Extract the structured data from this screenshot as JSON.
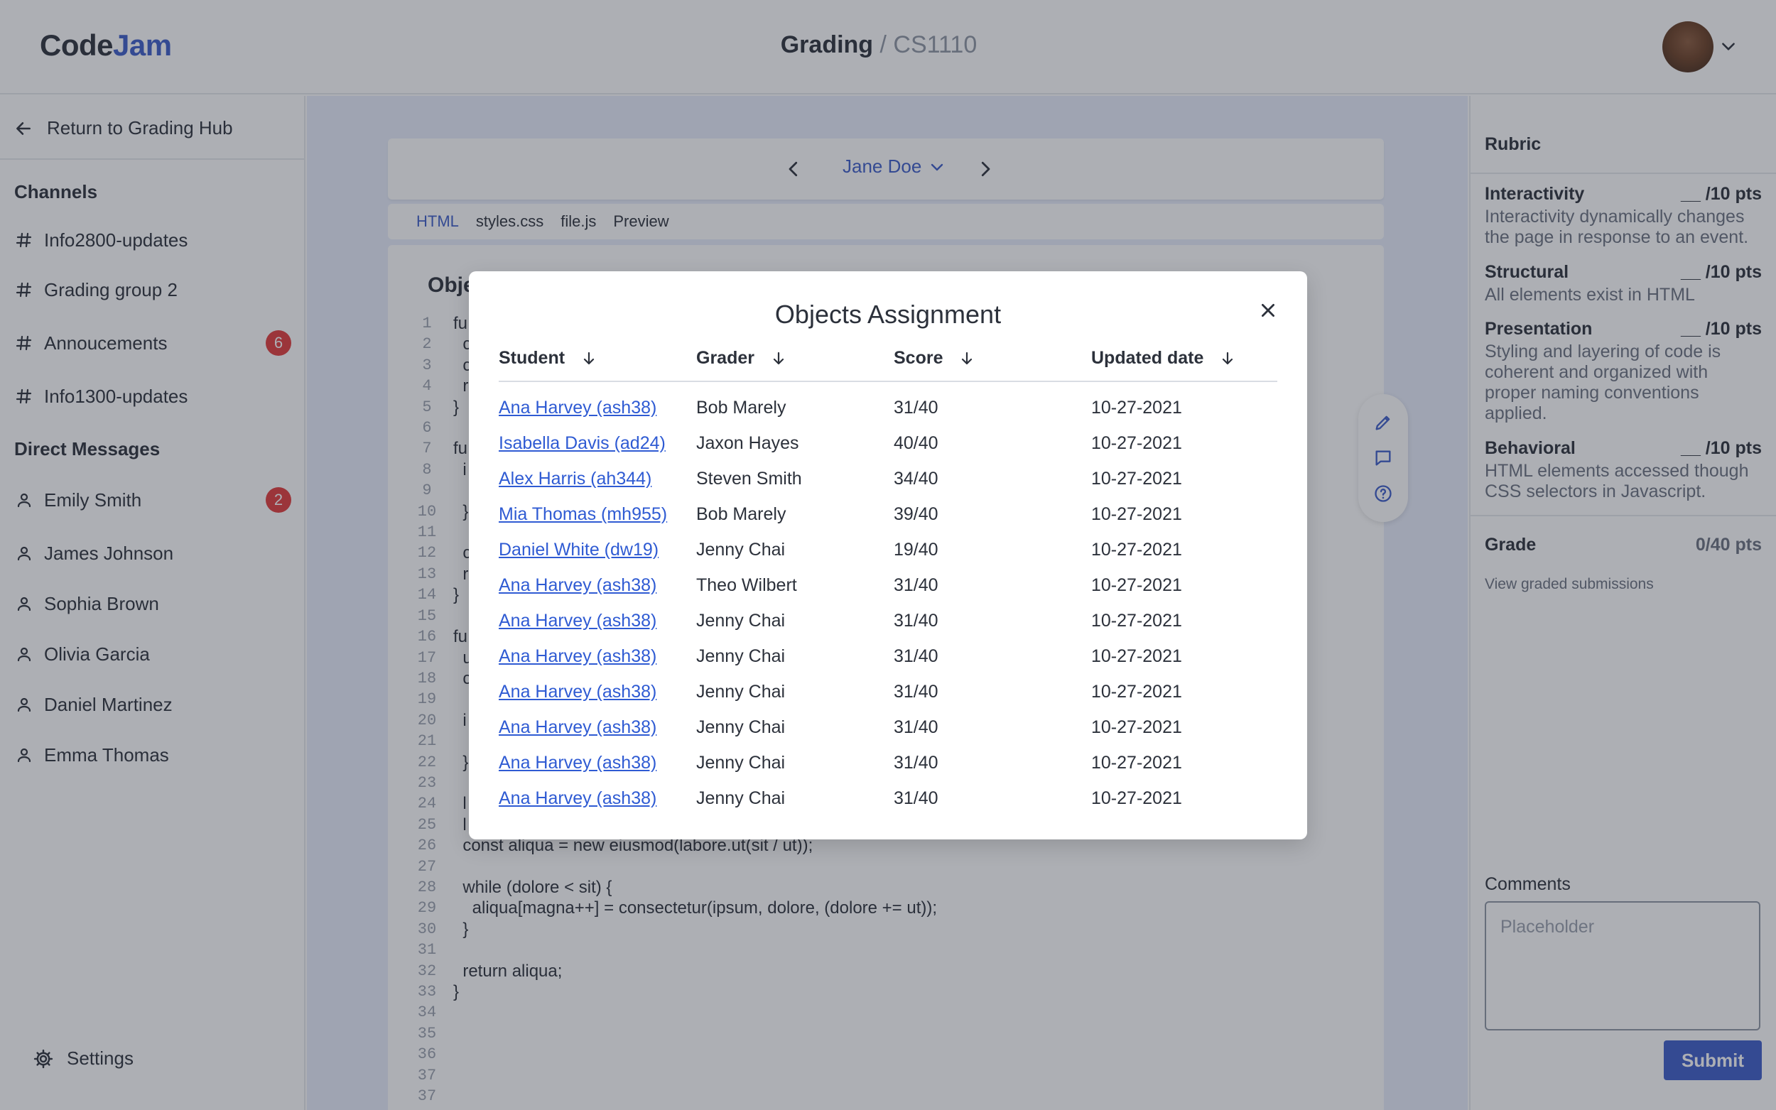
{
  "header": {
    "logo_part1": "Code",
    "logo_part2": "Jam",
    "title_main": "Grading",
    "title_sep": " / ",
    "title_course": "CS1110"
  },
  "sidebar": {
    "return_label": "Return to Grading Hub",
    "channels_title": "Channels",
    "channels": [
      {
        "label": "Info2800-updates",
        "badge": ""
      },
      {
        "label": "Grading group 2",
        "badge": ""
      },
      {
        "label": "Annoucements",
        "badge": "6"
      },
      {
        "label": "Info1300-updates",
        "badge": ""
      }
    ],
    "dm_title": "Direct Messages",
    "dms": [
      {
        "label": "Emily Smith",
        "badge": "2"
      },
      {
        "label": "James Johnson",
        "badge": ""
      },
      {
        "label": "Sophia Brown",
        "badge": ""
      },
      {
        "label": "Olivia Garcia",
        "badge": ""
      },
      {
        "label": "Daniel Martinez",
        "badge": ""
      },
      {
        "label": "Emma Thomas",
        "badge": ""
      }
    ],
    "settings_label": "Settings"
  },
  "main": {
    "student_name": "Jane Doe",
    "file_tabs": [
      "HTML",
      "styles.css",
      "file.js",
      "Preview"
    ],
    "active_tab": "HTML",
    "code_title": "Obje",
    "line_numbers": [
      "1",
      "2",
      "3",
      "4",
      "5",
      "6",
      "7",
      "8",
      "9",
      "10",
      "11",
      "12",
      "13",
      "14",
      "15",
      "16",
      "17",
      "18",
      "19",
      "20",
      "21",
      "22",
      "23",
      "24",
      "25",
      "26",
      "27",
      "28",
      "29",
      "30",
      "31",
      "32",
      "33",
      "34",
      "35",
      "36",
      "37",
      "37"
    ],
    "code_lines": [
      "fu",
      "  c",
      "  c",
      "  r",
      "}",
      "",
      "fu",
      "  i",
      "",
      "  }",
      "",
      "  c",
      "  r",
      "}",
      "",
      "fu",
      "  u",
      "  c",
      "",
      "  i",
      "",
      "  }",
      "",
      "  l",
      "  l",
      "  const aliqua = new eiusmod(labore.ut(sit / ut));",
      "",
      "  while (dolore < sit) {",
      "    aliqua[magna++] = consectetur(ipsum, dolore, (dolore += ut));",
      "  }",
      "",
      "  return aliqua;",
      "}",
      "",
      "",
      "",
      "",
      ""
    ]
  },
  "rubric": {
    "title": "Rubric",
    "criteria": [
      {
        "name": "Interactivity",
        "points": "__ /10 pts",
        "desc": "Interactivity dynamically changes the page in response to an event."
      },
      {
        "name": "Structural",
        "points": "__ /10 pts",
        "desc": "All elements exist in HTML"
      },
      {
        "name": "Presentation",
        "points": "__ /10 pts",
        "desc": "Styling and layering of code is coherent and organized with proper naming conventions applied."
      },
      {
        "name": "Behavioral",
        "points": "__ /10 pts",
        "desc": "HTML elements accessed though CSS selectors in Javascript."
      }
    ],
    "grade_label": "Grade",
    "grade_value": "0/40 pts",
    "view_link": "View graded submissions",
    "comments_label": "Comments",
    "comments_placeholder": "Placeholder",
    "submit_label": "Submit"
  },
  "modal": {
    "title": "Objects Assignment",
    "columns": [
      "Student",
      "Grader",
      "Score",
      "Updated date"
    ],
    "rows": [
      {
        "student": "Ana Harvey (ash38)",
        "grader": "Bob Marely",
        "score": "31/40",
        "date": "10-27-2021"
      },
      {
        "student": "Isabella Davis (ad24)",
        "grader": "Jaxon Hayes",
        "score": "40/40",
        "date": "10-27-2021"
      },
      {
        "student": "Alex Harris (ah344)",
        "grader": "Steven Smith",
        "score": "34/40",
        "date": "10-27-2021"
      },
      {
        "student": "Mia Thomas (mh955)",
        "grader": "Bob Marely",
        "score": "39/40",
        "date": "10-27-2021"
      },
      {
        "student": "Daniel White (dw19)",
        "grader": "Jenny Chai",
        "score": "19/40",
        "date": "10-27-2021"
      },
      {
        "student": "Ana Harvey (ash38)",
        "grader": "Theo Wilbert",
        "score": "31/40",
        "date": "10-27-2021"
      },
      {
        "student": "Ana Harvey (ash38)",
        "grader": "Jenny Chai",
        "score": "31/40",
        "date": "10-27-2021"
      },
      {
        "student": "Ana Harvey (ash38)",
        "grader": "Jenny Chai",
        "score": "31/40",
        "date": "10-27-2021"
      },
      {
        "student": "Ana Harvey (ash38)",
        "grader": "Jenny Chai",
        "score": "31/40",
        "date": "10-27-2021"
      },
      {
        "student": "Ana Harvey (ash38)",
        "grader": "Jenny Chai",
        "score": "31/40",
        "date": "10-27-2021"
      },
      {
        "student": "Ana Harvey (ash38)",
        "grader": "Jenny Chai",
        "score": "31/40",
        "date": "10-27-2021"
      },
      {
        "student": "Ana Harvey (ash38)",
        "grader": "Jenny Chai",
        "score": "31/40",
        "date": "10-27-2021"
      }
    ]
  },
  "colors": {
    "accent": "#3d5dc9",
    "badge": "#e23b3b",
    "link": "#2f5bd3"
  }
}
